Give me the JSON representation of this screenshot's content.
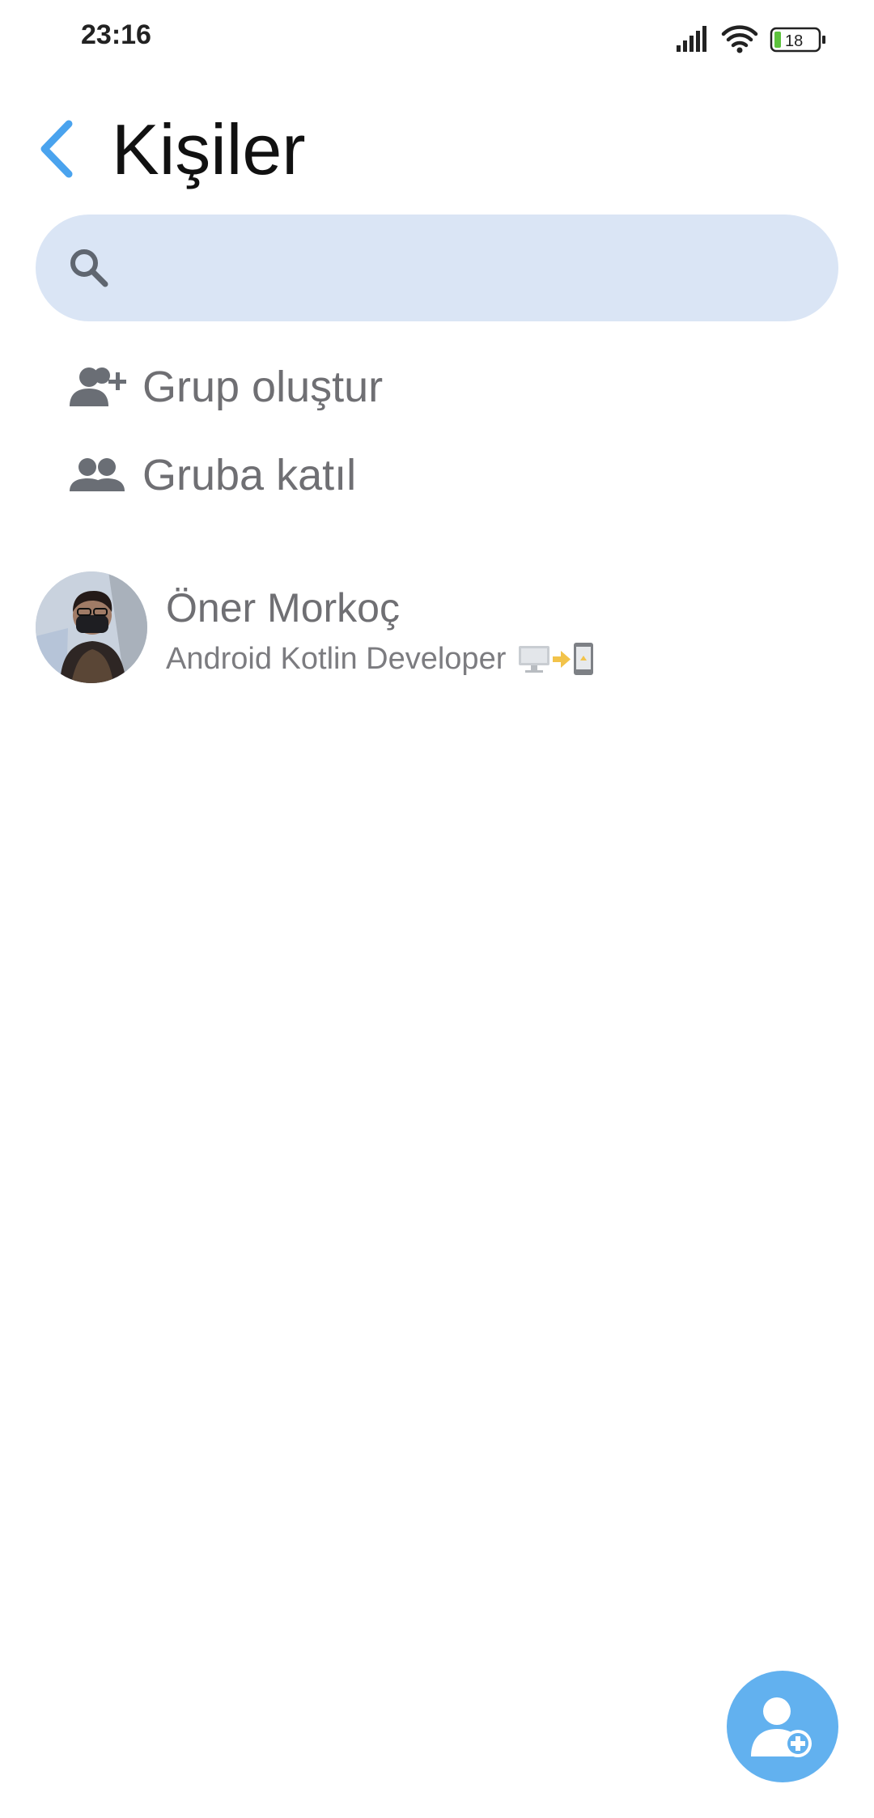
{
  "status_bar": {
    "time": "23:16",
    "battery_level": "18",
    "icons": [
      "signal-icon",
      "wifi-icon",
      "battery-icon"
    ]
  },
  "header": {
    "title": "Kişiler",
    "back_icon": "chevron-left-icon"
  },
  "search": {
    "placeholder": "",
    "icon": "search-icon"
  },
  "actions": [
    {
      "label": "Grup oluştur",
      "icon": "group-add-icon"
    },
    {
      "label": "Gruba katıl",
      "icon": "group-icon"
    }
  ],
  "contacts": [
    {
      "name": "Öner Morkoç",
      "status": "Android Kotlin Developer",
      "status_emoji": [
        "desktop-computer-icon",
        "right-arrow-icon",
        "mobile-phone-icon"
      ]
    }
  ],
  "fab": {
    "icon": "add-contact-icon"
  },
  "colors": {
    "accent": "#62b1ef",
    "search_bg": "#dae5f5",
    "text_gray": "#6f6f73",
    "battery_green": "#5cc23c"
  }
}
